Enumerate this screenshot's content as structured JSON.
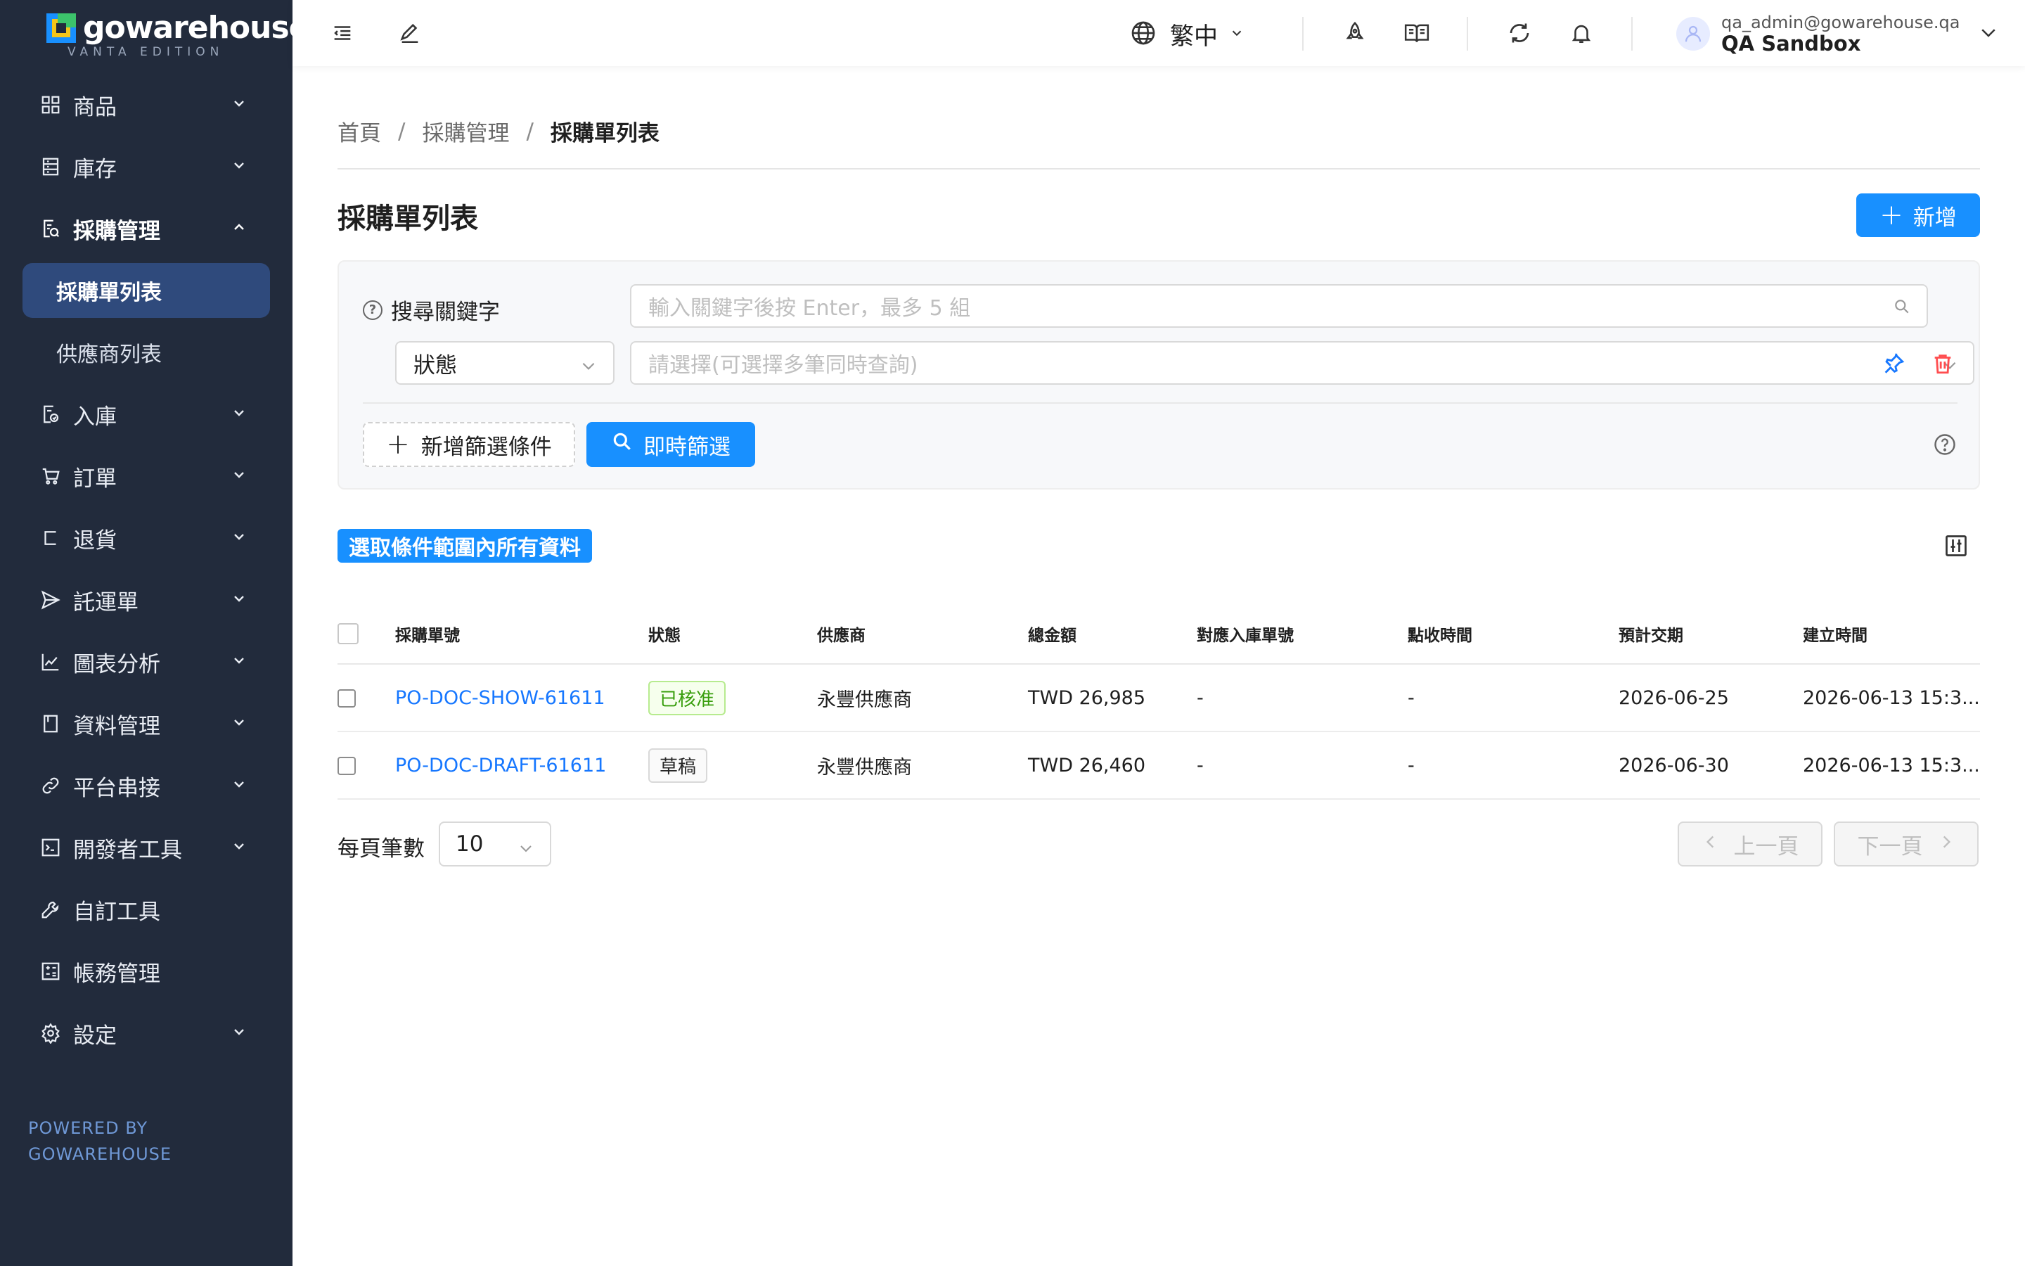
{
  "brand": {
    "name": "gowarehouse",
    "edition": "VANTA EDITION",
    "powered_line1": "POWERED BY",
    "powered_line2": "GOWAREHOUSE"
  },
  "sidebar": {
    "items": [
      {
        "label": "商品",
        "icon": "grid-icon"
      },
      {
        "label": "庫存",
        "icon": "inventory-icon"
      },
      {
        "label": "採購管理",
        "icon": "purchase-icon"
      },
      {
        "label": "入庫",
        "icon": "inbound-icon"
      },
      {
        "label": "訂單",
        "icon": "cart-icon"
      },
      {
        "label": "退貨",
        "icon": "return-icon"
      },
      {
        "label": "託運單",
        "icon": "send-icon"
      },
      {
        "label": "圖表分析",
        "icon": "chart-icon"
      },
      {
        "label": "資料管理",
        "icon": "book-icon"
      },
      {
        "label": "平台串接",
        "icon": "link-icon"
      },
      {
        "label": "開發者工具",
        "icon": "terminal-icon"
      },
      {
        "label": "自訂工具",
        "icon": "wrench-icon"
      },
      {
        "label": "帳務管理",
        "icon": "calculator-icon"
      },
      {
        "label": "設定",
        "icon": "gear-icon"
      }
    ],
    "sub_items": [
      "採購單列表",
      "供應商列表"
    ]
  },
  "header": {
    "language": "繁中",
    "user_email": "qa_admin@gowarehouse.qa",
    "user_name": "QA Sandbox"
  },
  "breadcrumb": [
    "首頁",
    "採購管理",
    "採購單列表"
  ],
  "page": {
    "title": "採購單列表",
    "add_button": "新增"
  },
  "filter": {
    "keyword_label": "搜尋關鍵字",
    "keyword_placeholder": "輸入關鍵字後按 Enter，最多 5 組",
    "status_field": "狀態",
    "status_placeholder": "請選擇(可選擇多筆同時查詢)",
    "add_condition": "新增篩選條件",
    "instant_filter": "即時篩選"
  },
  "select_all_button": "選取條件範圍內所有資料",
  "table": {
    "columns": [
      "採購單號",
      "狀態",
      "供應商",
      "總金額",
      "對應入庫單號",
      "點收時間",
      "預計交期",
      "建立時間"
    ],
    "rows": [
      {
        "po": "PO-DOC-SHOW-61611",
        "status": "已核准",
        "supplier": "永豐供應商",
        "amount": "TWD 26,985",
        "inbound": "-",
        "received": "-",
        "expected": "2026-06-25",
        "created": "2026-06-13 15:3..."
      },
      {
        "po": "PO-DOC-DRAFT-61611",
        "status": "草稿",
        "supplier": "永豐供應商",
        "amount": "TWD 26,460",
        "inbound": "-",
        "received": "-",
        "expected": "2026-06-30",
        "created": "2026-06-13 15:3..."
      }
    ]
  },
  "pagination": {
    "per_page_label": "每頁筆數",
    "page_size": "10",
    "prev": "上一頁",
    "next": "下一頁"
  },
  "colors": {
    "sidebar_bg": "#222b3c",
    "active_item": "#2f4a7c",
    "primary": "#1890ff",
    "link": "#1677ff",
    "approved_green": "#389e0d",
    "delete_red": "#ff4d4f"
  }
}
